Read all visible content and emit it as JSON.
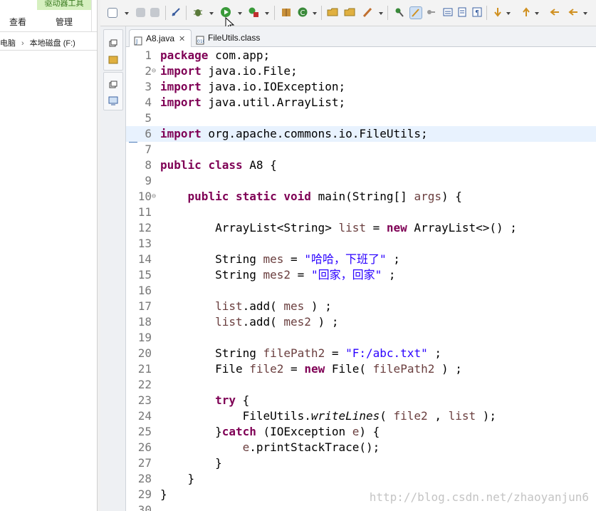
{
  "explorer": {
    "drive_tools_label": "驱动器工具",
    "view_tab": "查看",
    "manage_tab": "管理",
    "breadcrumb_pc": "电脑",
    "breadcrumb_sep": "›",
    "breadcrumb_drive": "本地磁盘 (F:)"
  },
  "tabs": [
    {
      "label": "A8.java",
      "close": "✕",
      "active": true
    },
    {
      "label": "FileUtils.class",
      "active": false
    }
  ],
  "editor": {
    "highlighted_line": 6,
    "lines": [
      {
        "num": "1",
        "code": "package com.app;"
      },
      {
        "num": "2",
        "code": "import java.io.File;",
        "fold": "⊖"
      },
      {
        "num": "3",
        "code": "import java.io.IOException;"
      },
      {
        "num": "4",
        "code": "import java.util.ArrayList;"
      },
      {
        "num": "5",
        "code": ""
      },
      {
        "num": "6",
        "code": "import org.apache.commons.io.FileUtils;"
      },
      {
        "num": "7",
        "code": ""
      },
      {
        "num": "8",
        "code": "public class A8 {"
      },
      {
        "num": "9",
        "code": ""
      },
      {
        "num": "10",
        "code": "    public static void main(String[] args) {",
        "fold": "⊖"
      },
      {
        "num": "11",
        "code": ""
      },
      {
        "num": "12",
        "code": "        ArrayList<String> list = new ArrayList<>() ;"
      },
      {
        "num": "13",
        "code": ""
      },
      {
        "num": "14",
        "code": "        String mes = \"哈哈，下班了\" ;"
      },
      {
        "num": "15",
        "code": "        String mes2 = \"回家，回家\" ;"
      },
      {
        "num": "16",
        "code": ""
      },
      {
        "num": "17",
        "code": "        list.add( mes ) ;"
      },
      {
        "num": "18",
        "code": "        list.add( mes2 ) ;"
      },
      {
        "num": "19",
        "code": ""
      },
      {
        "num": "20",
        "code": "        String filePath2 = \"F:/abc.txt\" ;"
      },
      {
        "num": "21",
        "code": "        File file2 = new File( filePath2 ) ;"
      },
      {
        "num": "22",
        "code": ""
      },
      {
        "num": "23",
        "code": "        try {"
      },
      {
        "num": "24",
        "code": "            FileUtils.writeLines( file2 , list );"
      },
      {
        "num": "25",
        "code": "        }catch (IOException e) {"
      },
      {
        "num": "26",
        "code": "            e.printStackTrace();"
      },
      {
        "num": "27",
        "code": "        }"
      },
      {
        "num": "28",
        "code": "    }"
      },
      {
        "num": "29",
        "code": "}"
      },
      {
        "num": "30",
        "code": ""
      }
    ]
  },
  "watermark": "http://blog.csdn.net/zhaoyanjun6",
  "colors": {
    "keyword": "#7f0055",
    "string": "#2a00ff",
    "variable": "#6a3e3e",
    "line_highlight": "#e8f2fe"
  }
}
